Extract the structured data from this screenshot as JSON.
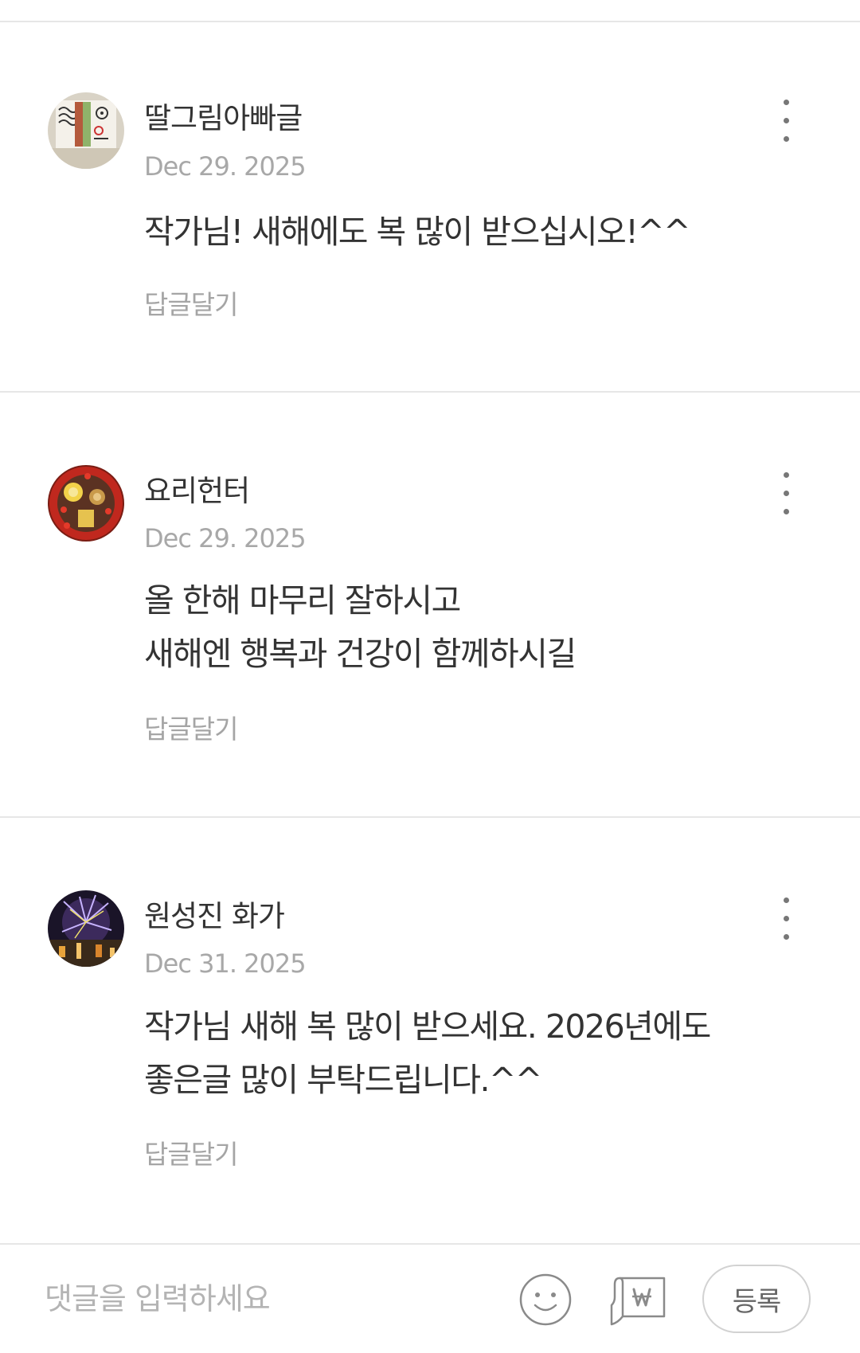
{
  "comments": [
    {
      "author": "딸그림아빠글",
      "date": "Dec 29. 2025",
      "lines": [
        "작가님!  새해에도 복 많이 받으십시오!^^"
      ],
      "reply_label": "답글달기",
      "more_icon": "more-vertical-icon"
    },
    {
      "author": "요리헌터",
      "date": "Dec 29. 2025",
      "lines": [
        "올 한해 마무리 잘하시고",
        "새해엔 행복과 건강이 함께하시길"
      ],
      "reply_label": "답글달기",
      "more_icon": "more-vertical-icon"
    },
    {
      "author": "원성진 화가",
      "date": "Dec 31. 2025",
      "lines": [
        "작가님 새해 복 많이 받으세요. 2026년에도",
        "좋은글 많이 부탁드립니다.^^"
      ],
      "reply_label": "답글달기",
      "more_icon": "more-vertical-icon"
    }
  ],
  "input_bar": {
    "placeholder": "댓글을 입력하세요",
    "value": "",
    "emoji_icon": "smiley-icon",
    "coin_icon": "won-tip-icon",
    "submit_label": "등록"
  },
  "colors": {
    "text_primary": "#333333",
    "text_secondary": "#a8a8a8",
    "divider": "#e6e6e6"
  }
}
